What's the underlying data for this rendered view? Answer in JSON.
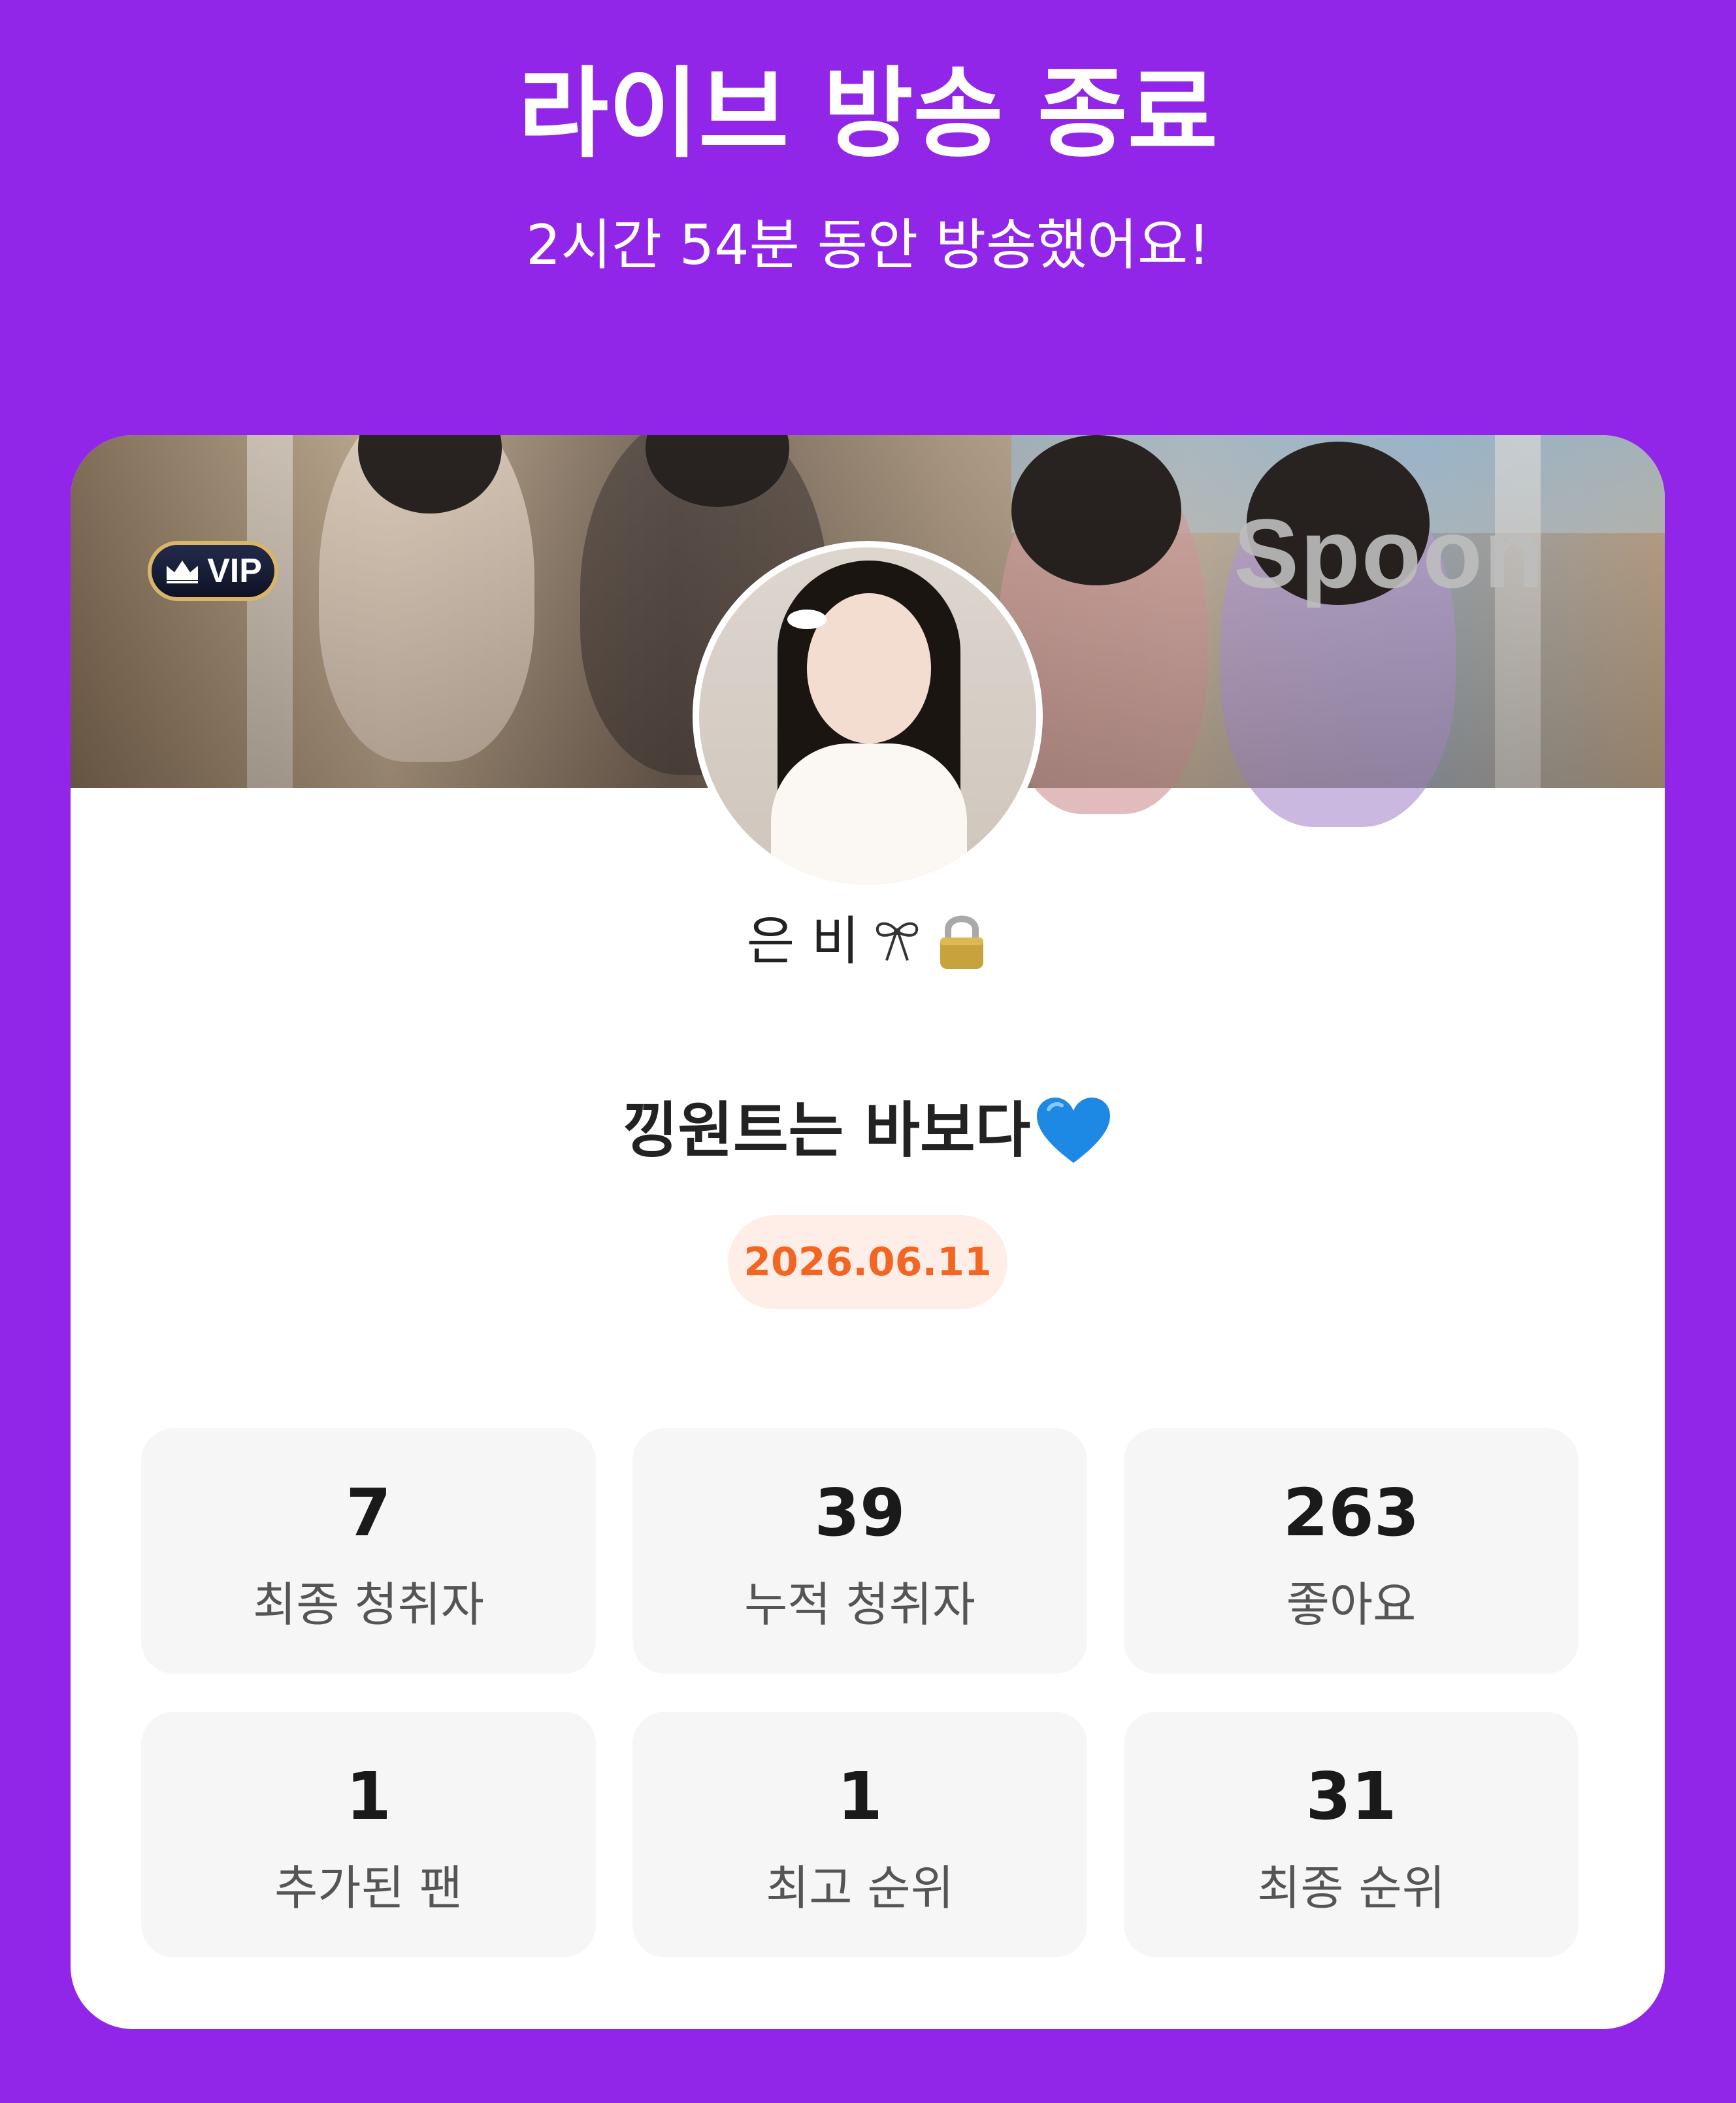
{
  "header": {
    "title": "라이브 방송 종료",
    "subtitle": "2시간 54분 동안 방송했어요!"
  },
  "card": {
    "banner_watermark": "Spoon",
    "vip_badge": "VIP",
    "nickname": "은 비",
    "nickname_icons": [
      "ribbon-bow-icon",
      "lock-icon"
    ],
    "live_title": "낑원트는 바보다",
    "live_title_icon": "blue-heart-icon",
    "date": "2026.06.11"
  },
  "stats": [
    {
      "value": "7",
      "label": "최종 청취자"
    },
    {
      "value": "39",
      "label": "누적 청취자"
    },
    {
      "value": "263",
      "label": "좋아요"
    },
    {
      "value": "1",
      "label": "추가된 팬"
    },
    {
      "value": "1",
      "label": "최고 순위"
    },
    {
      "value": "31",
      "label": "최종 순위"
    }
  ],
  "colors": {
    "background": "#9226E8",
    "date_text": "#F26522",
    "date_pill": "#FFEEE8",
    "stat_tile": "#F6F6F6",
    "heart": "#1E88E5"
  }
}
